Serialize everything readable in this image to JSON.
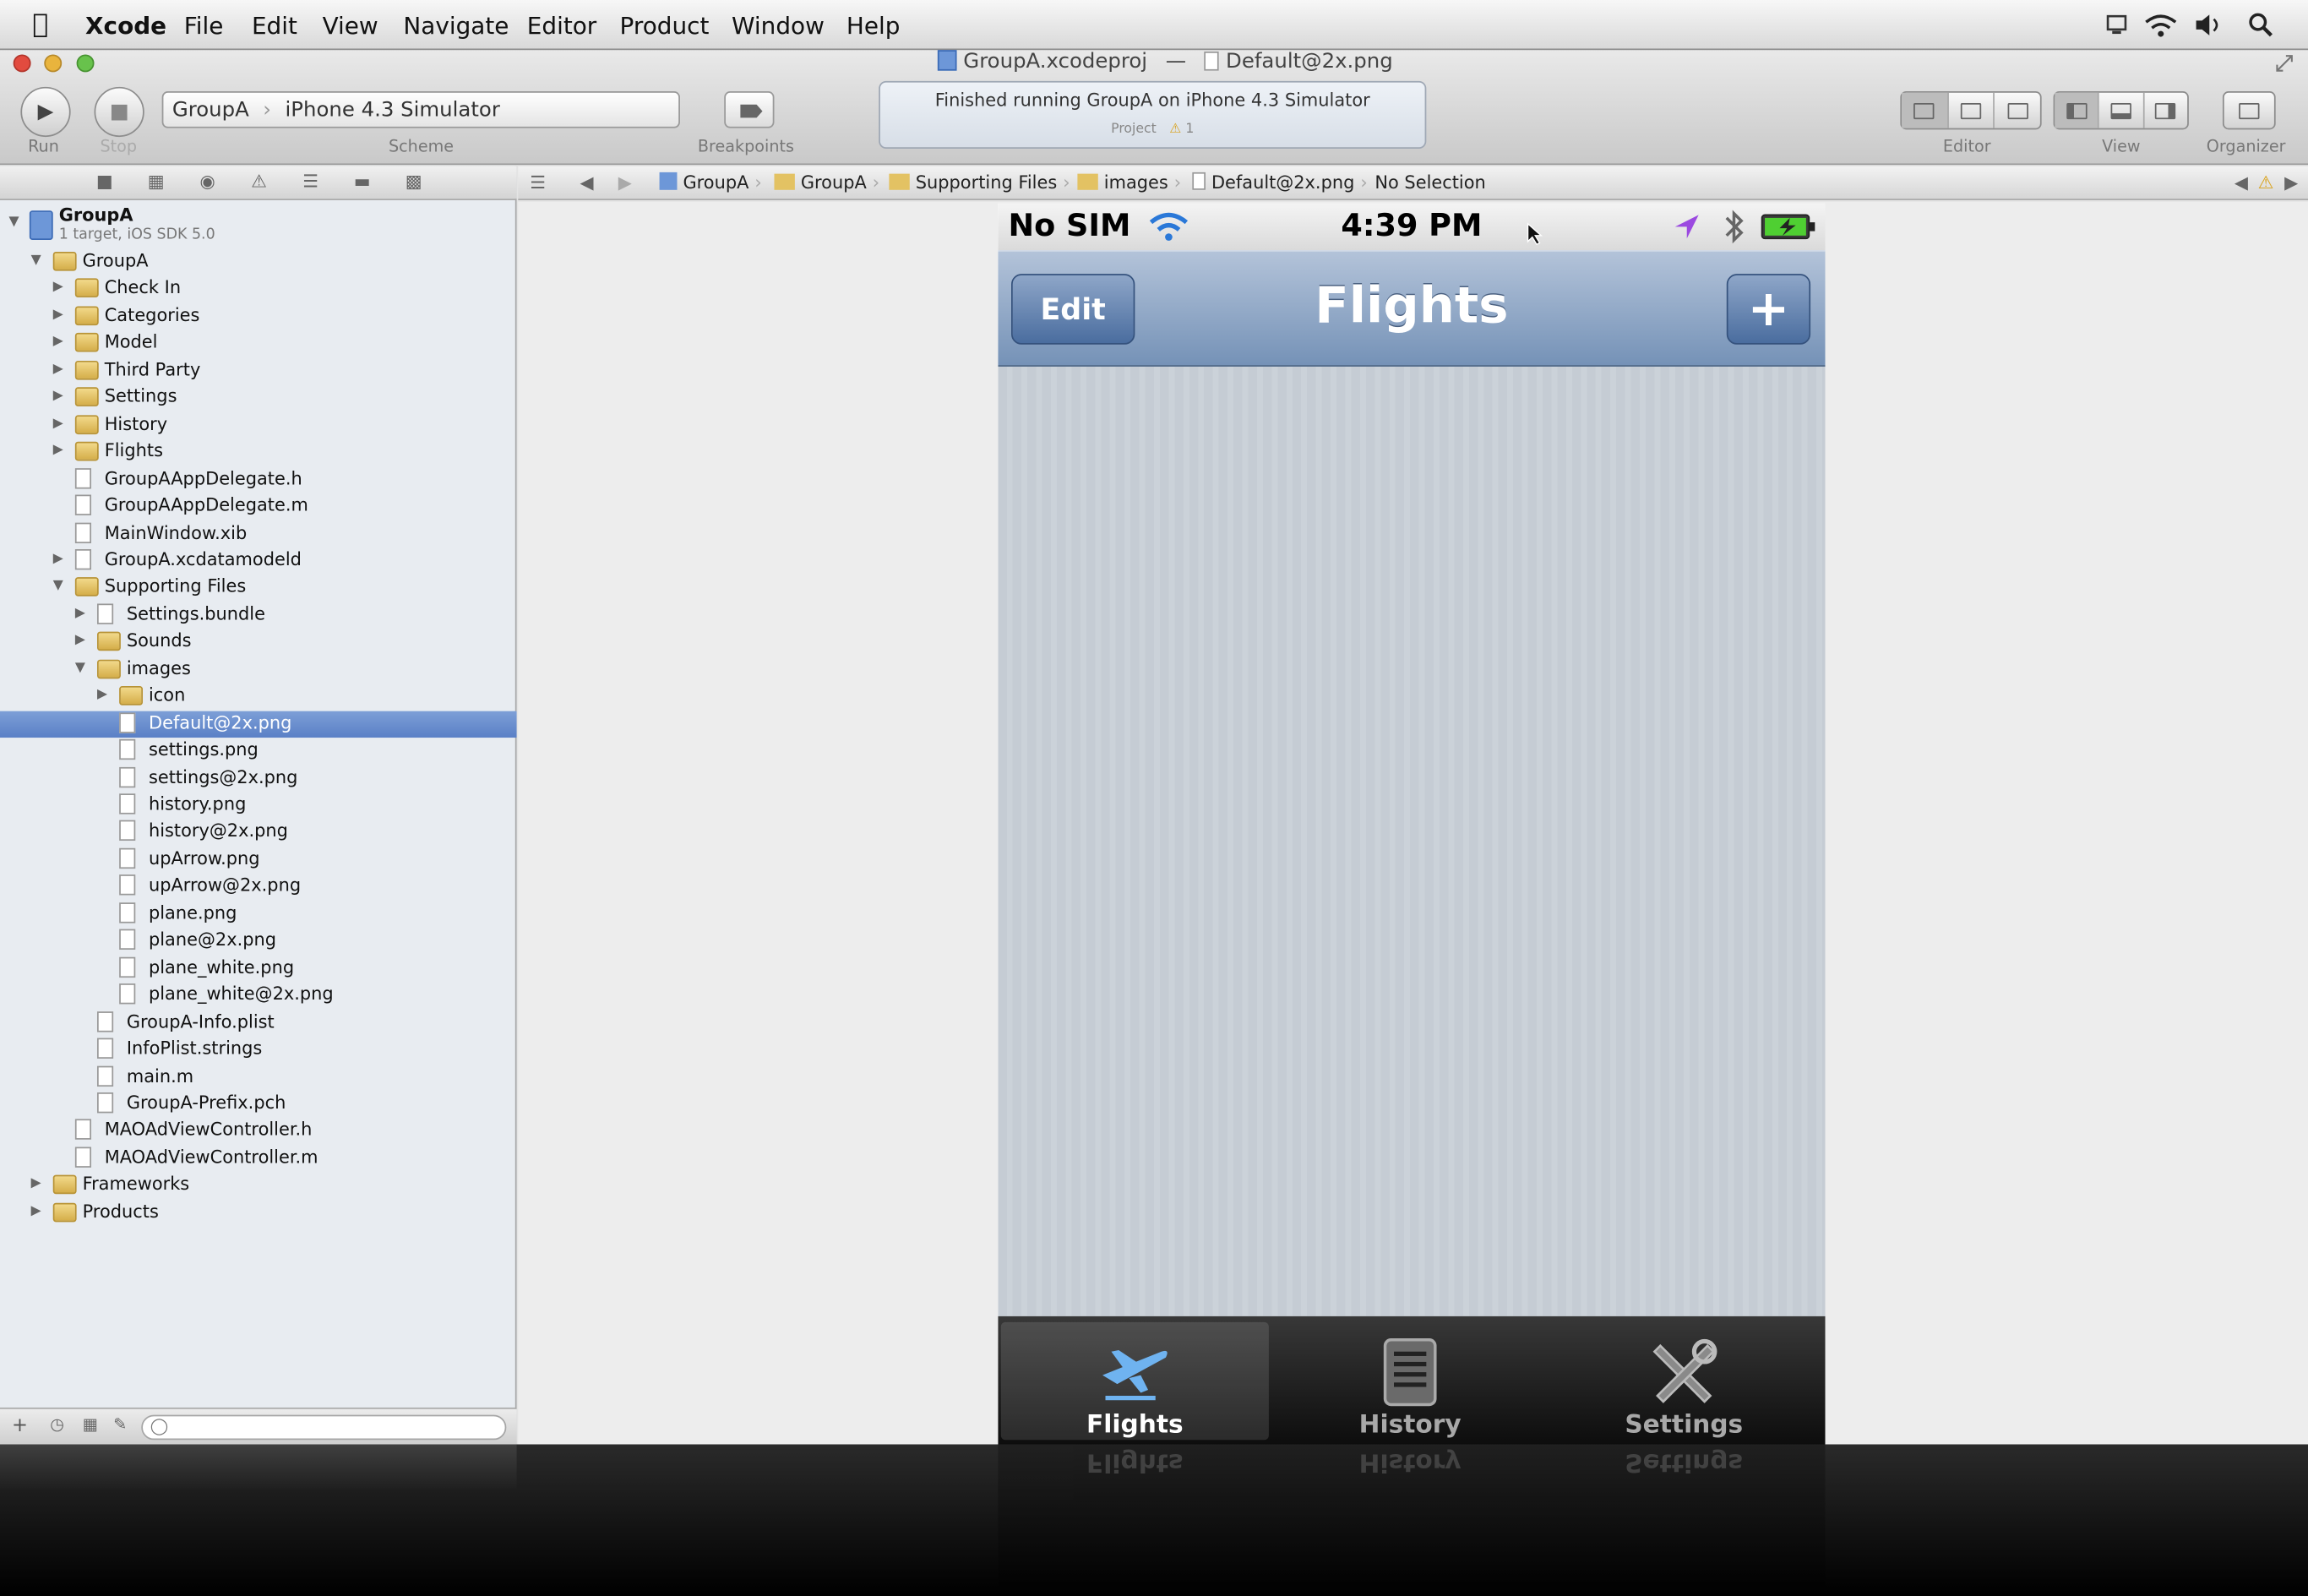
{
  "menubar": {
    "apple": "",
    "app": "Xcode",
    "items": [
      "File",
      "Edit",
      "View",
      "Navigate",
      "Editor",
      "Product",
      "Window",
      "Help"
    ]
  },
  "window": {
    "title_project": "GroupA.xcodeproj",
    "title_sep": "—",
    "title_file": "Default@2x.png"
  },
  "toolbar": {
    "run_label": "Run",
    "stop_label": "Stop",
    "scheme_target": "GroupA",
    "scheme_device": "iPhone 4.3 Simulator",
    "scheme_label": "Scheme",
    "breakpoints_label": "Breakpoints",
    "activity_message": "Finished running GroupA on iPhone 4.3 Simulator",
    "activity_project": "Project",
    "activity_warnings": "1",
    "editor_label": "Editor",
    "view_label": "View",
    "organizer_label": "Organizer"
  },
  "navigator": {
    "project_name": "GroupA",
    "project_sub": "1 target, iOS SDK 5.0",
    "tree": [
      {
        "label": "GroupA",
        "kind": "folder",
        "depth": 1,
        "open": true
      },
      {
        "label": "Check In",
        "kind": "folder",
        "depth": 2,
        "open": false
      },
      {
        "label": "Categories",
        "kind": "folder",
        "depth": 2,
        "open": false
      },
      {
        "label": "Model",
        "kind": "folder",
        "depth": 2,
        "open": false
      },
      {
        "label": "Third Party",
        "kind": "folder",
        "depth": 2,
        "open": false
      },
      {
        "label": "Settings",
        "kind": "folder",
        "depth": 2,
        "open": false
      },
      {
        "label": "History",
        "kind": "folder",
        "depth": 2,
        "open": false
      },
      {
        "label": "Flights",
        "kind": "folder",
        "depth": 2,
        "open": false
      },
      {
        "label": "GroupAAppDelegate.h",
        "kind": "file",
        "depth": 2
      },
      {
        "label": "GroupAAppDelegate.m",
        "kind": "file",
        "depth": 2
      },
      {
        "label": "MainWindow.xib",
        "kind": "file",
        "depth": 2
      },
      {
        "label": "GroupA.xcdatamodeld",
        "kind": "file",
        "depth": 2,
        "open": false
      },
      {
        "label": "Supporting Files",
        "kind": "folder",
        "depth": 2,
        "open": true
      },
      {
        "label": "Settings.bundle",
        "kind": "file",
        "depth": 3,
        "open": false
      },
      {
        "label": "Sounds",
        "kind": "folder",
        "depth": 3,
        "open": false
      },
      {
        "label": "images",
        "kind": "folder",
        "depth": 3,
        "open": true
      },
      {
        "label": "icon",
        "kind": "folder",
        "depth": 4,
        "open": false
      },
      {
        "label": "Default@2x.png",
        "kind": "file",
        "depth": 4,
        "selected": true
      },
      {
        "label": "settings.png",
        "kind": "file",
        "depth": 4
      },
      {
        "label": "settings@2x.png",
        "kind": "file",
        "depth": 4
      },
      {
        "label": "history.png",
        "kind": "file",
        "depth": 4
      },
      {
        "label": "history@2x.png",
        "kind": "file",
        "depth": 4
      },
      {
        "label": "upArrow.png",
        "kind": "file",
        "depth": 4
      },
      {
        "label": "upArrow@2x.png",
        "kind": "file",
        "depth": 4
      },
      {
        "label": "plane.png",
        "kind": "file",
        "depth": 4
      },
      {
        "label": "plane@2x.png",
        "kind": "file",
        "depth": 4
      },
      {
        "label": "plane_white.png",
        "kind": "file",
        "depth": 4
      },
      {
        "label": "plane_white@2x.png",
        "kind": "file",
        "depth": 4
      },
      {
        "label": "GroupA-Info.plist",
        "kind": "file",
        "depth": 3
      },
      {
        "label": "InfoPlist.strings",
        "kind": "file",
        "depth": 3
      },
      {
        "label": "main.m",
        "kind": "file",
        "depth": 3
      },
      {
        "label": "GroupA-Prefix.pch",
        "kind": "file",
        "depth": 3
      },
      {
        "label": "MAOAdViewController.h",
        "kind": "file",
        "depth": 2
      },
      {
        "label": "MAOAdViewController.m",
        "kind": "file",
        "depth": 2
      },
      {
        "label": "Frameworks",
        "kind": "folder",
        "depth": 1,
        "open": false
      },
      {
        "label": "Products",
        "kind": "folder",
        "depth": 1,
        "open": false
      }
    ]
  },
  "jumpbar": {
    "crumbs": [
      "GroupA",
      "GroupA",
      "Supporting Files",
      "images",
      "Default@2x.png",
      "No Selection"
    ]
  },
  "phone": {
    "carrier": "No SIM",
    "time": "4:39 PM",
    "nav_title": "Flights",
    "edit_label": "Edit",
    "add_label": "+",
    "tabs": [
      {
        "label": "Flights",
        "icon": "plane-icon",
        "active": true
      },
      {
        "label": "History",
        "icon": "history-icon",
        "active": false
      },
      {
        "label": "Settings",
        "icon": "settings-icon",
        "active": false
      }
    ]
  },
  "colors": {
    "nav_blue": "#7592b7",
    "selection_blue": "#5a80c6",
    "tabbar_black": "#0d0d0d"
  }
}
